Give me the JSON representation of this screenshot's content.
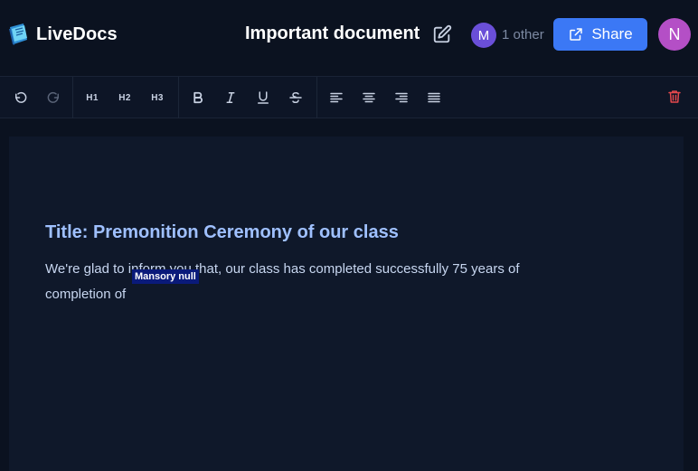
{
  "app": {
    "name": "LiveDocs"
  },
  "header": {
    "doc_title": "Important document",
    "collaborator_initial": "M",
    "collaborator_count_label": "1 other",
    "share_label": "Share",
    "user_initial": "N"
  },
  "toolbar": {
    "h1": "H1",
    "h2": "H2",
    "h3": "H3"
  },
  "document": {
    "heading": "Title: Premonition Ceremony of our class",
    "body": "We're glad to inform you that, our class has completed successfully 75 years of completion of",
    "cursor_label": "Mansory null"
  },
  "colors": {
    "background": "#0b1220",
    "accent": "#3b78f5",
    "heading": "#9fc0ff",
    "delete": "#e5484d"
  }
}
